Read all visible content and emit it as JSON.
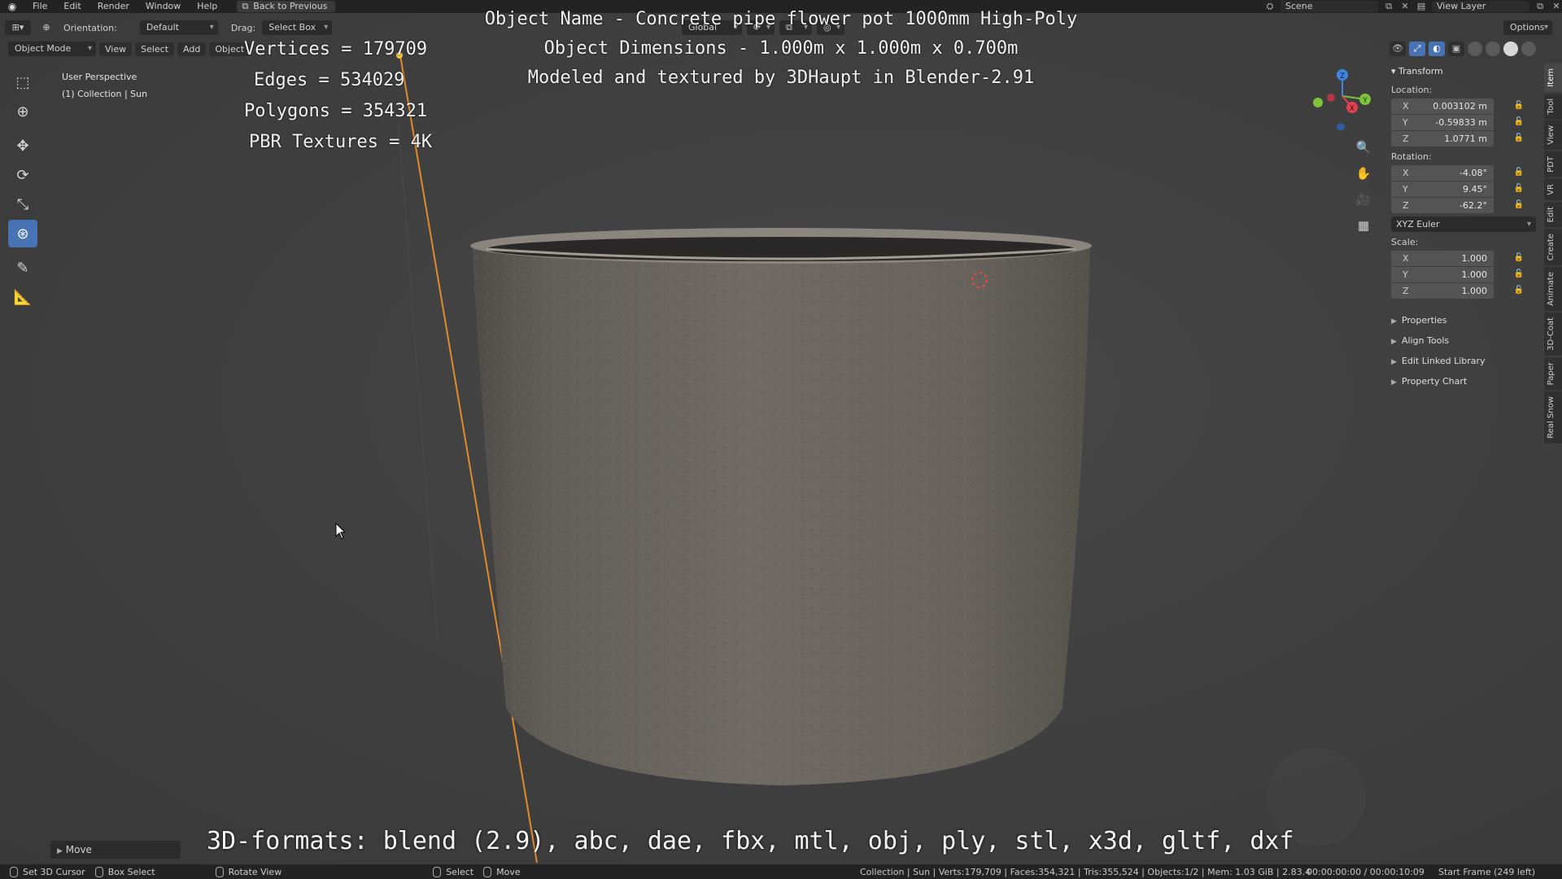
{
  "topbar": {
    "menus": [
      "File",
      "Edit",
      "Render",
      "Window",
      "Help"
    ],
    "back_button": "Back to Previous",
    "scene_name": "Scene",
    "view_layer": "View Layer"
  },
  "header": {
    "orientation_label": "Orientation:",
    "orientation_value": "Default",
    "drag_label": "Drag:",
    "drag_value": "Select Box",
    "transform_orientation": "Global",
    "options_label": "Options"
  },
  "header2": {
    "mode": "Object Mode",
    "menus": [
      "View",
      "Select",
      "Add",
      "Object"
    ]
  },
  "viewport_info": {
    "view_name": "User Perspective",
    "collection": "(1) Collection | Sun"
  },
  "overlay": {
    "stats": [
      "Vertices = 179709",
      "Edges = 534029",
      "Polygons = 354321",
      "PBR Textures = 4K"
    ],
    "title_lines": [
      "Object Name - Concrete pipe flower pot 1000mm High-Poly",
      "Object Dimensions -  1.000m x 1.000m x 0.700m",
      "Modeled and textured by 3DHaupt in Blender-2.91"
    ],
    "formats": "3D-formats: blend (2.9), abc, dae, fbx, mtl, obj, ply, stl, x3d, gltf, dxf"
  },
  "npanel": {
    "transform_header": "Transform",
    "location_label": "Location:",
    "location": [
      {
        "axis": "X",
        "value": "0.003102 m"
      },
      {
        "axis": "Y",
        "value": "-0.59833 m"
      },
      {
        "axis": "Z",
        "value": "1.0771 m"
      }
    ],
    "rotation_label": "Rotation:",
    "rotation": [
      {
        "axis": "X",
        "value": "-4.08°"
      },
      {
        "axis": "Y",
        "value": "9.45°"
      },
      {
        "axis": "Z",
        "value": "-62.2°"
      }
    ],
    "rotation_mode": "XYZ Euler",
    "scale_label": "Scale:",
    "scale": [
      {
        "axis": "X",
        "value": "1.000"
      },
      {
        "axis": "Y",
        "value": "1.000"
      },
      {
        "axis": "Z",
        "value": "1.000"
      }
    ],
    "collapsed_panels": [
      "Properties",
      "Align Tools",
      "Edit Linked Library",
      "Property Chart"
    ]
  },
  "side_tabs": [
    "Item",
    "Tool",
    "View",
    "PDT",
    "VR",
    "Edit",
    "Create",
    "Animate",
    "3D-Coat",
    "Paper",
    "Real Snow"
  ],
  "operator_panel": "Move",
  "statusbar": {
    "hints": [
      "Set 3D Cursor",
      "Box Select",
      "Rotate View",
      "Select",
      "Move"
    ],
    "stats": "Collection | Sun | Verts:179,709 | Faces:354,321 | Tris:355,524 | Objects:1/2 | Mem: 1.03 GiB | 2.83.4",
    "timecode": "00:00:00:00 / 00:00:10:09",
    "frame": "Start Frame (249 left)"
  },
  "colors": {
    "accent": "#4772b3",
    "axis_x": "#e0424f",
    "axis_y": "#7dc43c",
    "axis_z": "#3f86e0",
    "background": "#3d3d3d",
    "concrete": "#6a665f"
  }
}
